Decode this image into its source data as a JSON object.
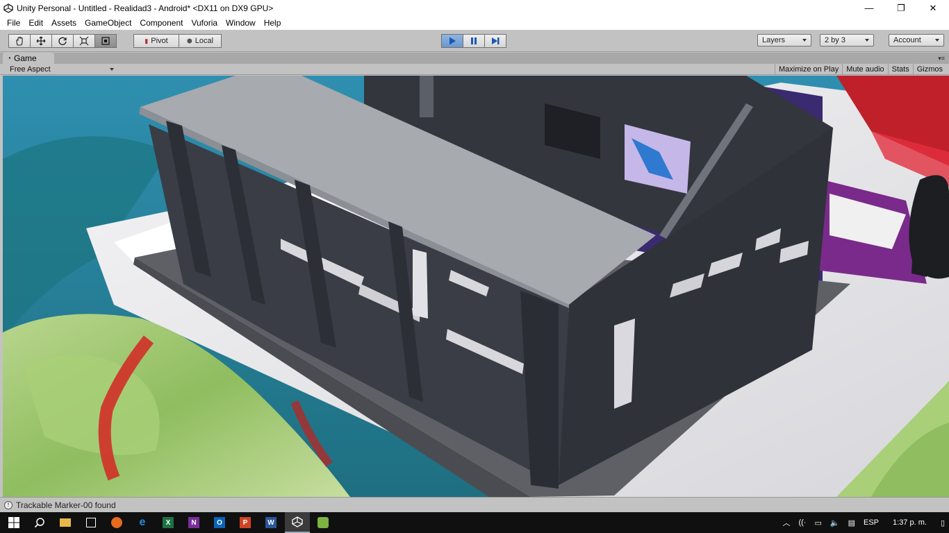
{
  "window": {
    "title": "Unity Personal - Untitled - Realidad3 - Android* <DX11 on DX9 GPU>",
    "minimize": "—",
    "restore": "❐",
    "close": "✕"
  },
  "menu": [
    "File",
    "Edit",
    "Assets",
    "GameObject",
    "Component",
    "Vuforia",
    "Window",
    "Help"
  ],
  "toolbar": {
    "pivot_label": "Pivot",
    "local_label": "Local",
    "layers_label": "Layers",
    "layout_label": "2 by 3",
    "account_label": "Account",
    "play_state": "playing"
  },
  "game_view": {
    "tab_label": "Game",
    "aspect": "Free Aspect",
    "maximize_on_play": "Maximize on Play",
    "mute_audio": "Mute audio",
    "stats": "Stats",
    "gizmos": "Gizmos"
  },
  "status": {
    "message": "Trackable Marker-00 found"
  },
  "taskbar": {
    "language": "ESP",
    "time": "1:37 p. m.",
    "apps": [
      "start-icon",
      "search-icon",
      "file-explorer-icon",
      "store-icon",
      "firefox-icon",
      "edge-icon",
      "excel-icon",
      "onenote-icon",
      "outlook-icon",
      "powerpoint-icon",
      "word-icon",
      "unity-icon",
      "android-icon"
    ]
  },
  "colors": {
    "play_blue": "#6c98cc",
    "unity_gray": "#c2c2c2",
    "model_dark": "#3a3d45",
    "model_light": "#a7aaaf"
  }
}
